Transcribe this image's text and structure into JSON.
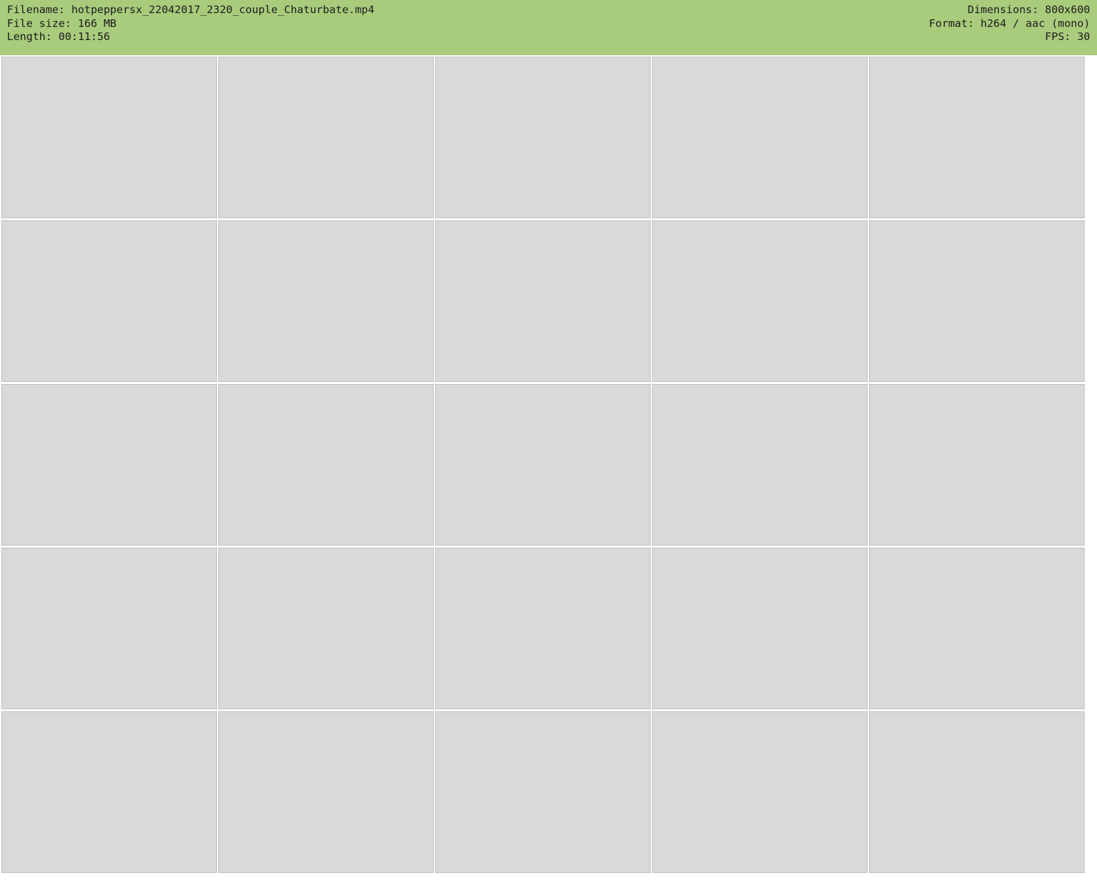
{
  "header": {
    "filename": "Filename: hotpeppersx_22042017_2320_couple_Chaturbate.mp4",
    "filesize": "File size: 166 MB",
    "length": "Length: 00:11:56",
    "dimensions": "Dimensions: 800x600",
    "format": "Format: h264 / aac (mono)",
    "fps": "FPS: 30"
  },
  "colors": {
    "header_bg": "#a8cb7c"
  }
}
